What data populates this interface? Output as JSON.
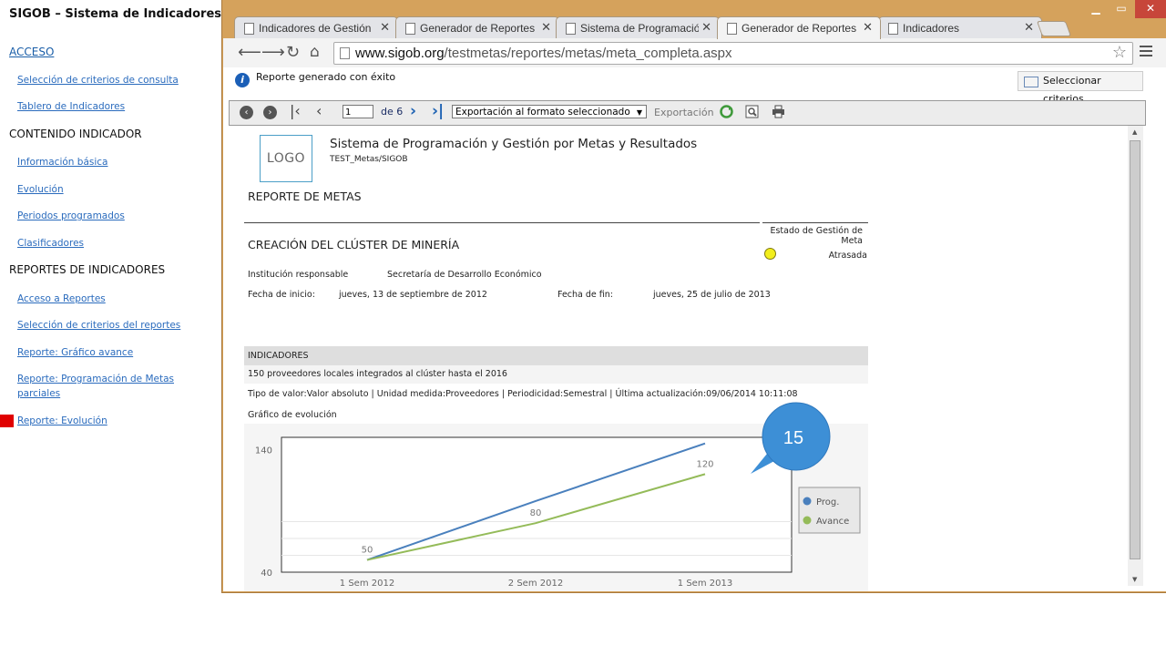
{
  "guide": {
    "title": "SIGOB – Sistema de Indicadores",
    "sections": [
      {
        "heading": "ACCESO",
        "heading_is_link": true,
        "items": [
          "Selección de criterios de consulta",
          "Tablero de Indicadores"
        ]
      },
      {
        "heading": "CONTENIDO INDICADOR",
        "heading_is_link": false,
        "items": [
          "Información básica",
          "Evolución",
          "Periodos programados",
          "Clasificadores"
        ]
      },
      {
        "heading": "REPORTES DE INDICADORES",
        "heading_is_link": false,
        "items": [
          "Acceso a Reportes",
          "Selección de criterios del reportes",
          "Reporte: Gráfico avance",
          "Reporte: Programación de Metas parciales",
          "Reporte: Evolución"
        ]
      }
    ],
    "current_item": "Reporte: Evolución",
    "marker_color": "#e00000"
  },
  "browser": {
    "tabs": [
      {
        "title": "Indicadores de Gestión",
        "active": false
      },
      {
        "title": "Generador de Reportes",
        "active": false
      },
      {
        "title": "Sistema de Programación",
        "active": false
      },
      {
        "title": "Generador de Reportes",
        "active": true
      },
      {
        "title": "Indicadores",
        "active": false
      }
    ],
    "url_host": "www.sigob.org",
    "url_path": "/testmetas/reportes/metas/meta_completa.aspx",
    "frame_color": "#d5a25c"
  },
  "page": {
    "status_message": "Reporte generado con éxito",
    "select_criteria_label": "Seleccionar criterios",
    "report_toolbar": {
      "page_value": "1",
      "page_of": "de 6",
      "export_format": "Exportación al formato seleccionado",
      "export_label": "Exportación"
    },
    "report": {
      "logo_text": "LOGO",
      "system_title": "Sistema de Programación y Gestión por Metas y Resultados",
      "system_subtitle": "TEST_Metas/SIGOB",
      "report_title": "REPORTE DE METAS",
      "goal_title": "CREACIÓN DEL CLÚSTER DE MINERÍA",
      "status_label": "Estado de Gestión de Meta",
      "status_value": "Atrasada",
      "status_color": "#f2ee1c",
      "institution_label": "Institución responsable",
      "institution_value": "Secretaría de Desarrollo Económico",
      "start_label": "Fecha de inicio:",
      "start_value": "jueves, 13 de septiembre de 2012",
      "end_label": "Fecha de fin:",
      "end_value": "jueves, 25 de julio de 2013",
      "indicators_header": "INDICADORES",
      "indicator_description": "150 proveedores locales integrados al clúster hasta el 2016",
      "indicator_meta": "Tipo de valor:Valor absoluto | Unidad medida:Proveedores | Periodicidad:Semestral | Última actualización:09/06/2014 10:11:08",
      "chart_label": "Gráfico de evolución"
    }
  },
  "callout": {
    "number": "15",
    "color": "#3d8fd6"
  },
  "chart_data": {
    "type": "line",
    "title": "",
    "xlabel": "",
    "ylabel": "",
    "categories": [
      "1 Sem 2012",
      "2 Sem 2012",
      "1 Sem 2013"
    ],
    "y_ticks": [
      40,
      140
    ],
    "ylim": [
      40,
      150
    ],
    "grid": true,
    "legend_position": "right",
    "series": [
      {
        "name": "Prog.",
        "color": "#4a80bd",
        "values": [
          50,
          98,
          145
        ]
      },
      {
        "name": "Avance",
        "color": "#94bb59",
        "values": [
          50,
          80,
          120
        ],
        "labels": [
          "50",
          "80",
          "120"
        ]
      }
    ]
  }
}
